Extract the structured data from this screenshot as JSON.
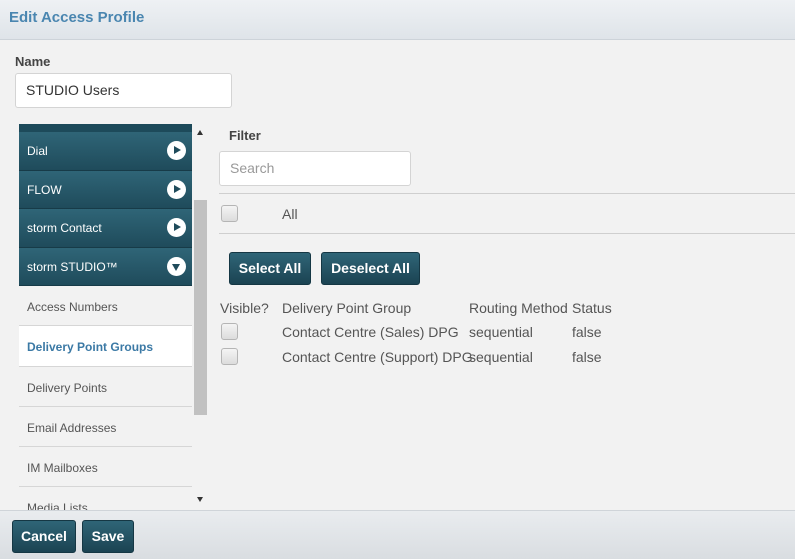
{
  "dialog": {
    "title": "Edit Access Profile"
  },
  "name_field": {
    "label": "Name",
    "value": "STUDIO Users"
  },
  "nav": {
    "groups": [
      {
        "label": "Dial",
        "state": "collapsed"
      },
      {
        "label": "FLOW",
        "state": "collapsed"
      },
      {
        "label": "storm Contact",
        "state": "collapsed"
      },
      {
        "label": "storm STUDIO™",
        "state": "expanded"
      }
    ],
    "items": [
      {
        "label": "Access Numbers"
      },
      {
        "label": "Delivery Point Groups",
        "active": true
      },
      {
        "label": "Delivery Points"
      },
      {
        "label": "Email Addresses"
      },
      {
        "label": "IM Mailboxes"
      },
      {
        "label": "Media Lists"
      }
    ]
  },
  "filter": {
    "label": "Filter",
    "placeholder": "Search"
  },
  "all_label": "All",
  "buttons": {
    "select_all": "Select All",
    "deselect_all": "Deselect All"
  },
  "table": {
    "headers": [
      "Visible?",
      "Delivery Point Group",
      "Routing Method",
      "Status"
    ],
    "rows": [
      {
        "group": "Contact Centre (Sales) DPG",
        "routing": "sequential",
        "status": "false",
        "visible": false
      },
      {
        "group": "Contact Centre (Support) DPG",
        "routing": "sequential",
        "status": "false",
        "visible": false
      }
    ]
  },
  "footer": {
    "cancel": "Cancel",
    "save": "Save"
  },
  "colors": {
    "accent": "#4a86b0",
    "nav_dark": "#1f4b5b",
    "active_link": "#3b79a5"
  }
}
